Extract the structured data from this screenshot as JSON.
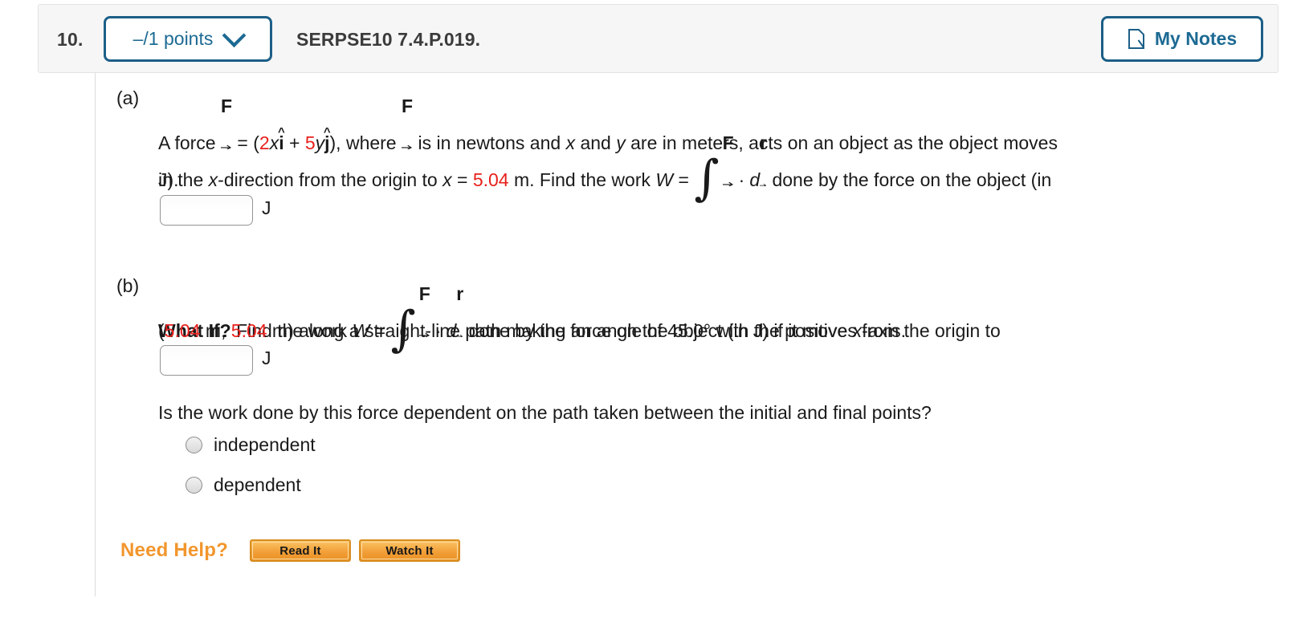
{
  "header": {
    "question_number": "10.",
    "points_label": "–/1 points",
    "points_chevron_icon": "chevron-down-icon",
    "question_code": "SERPSE10 7.4.P.019.",
    "notes_label": "My Notes",
    "notes_icon": "note-page-icon",
    "accent_color": "#1c6a93",
    "background": "#f6f6f6"
  },
  "parts": {
    "a": {
      "label": "(a)",
      "t1": "A force ",
      "force_sym": "F",
      "t2": " = (",
      "coef_x": "2",
      "var_x": "x",
      "ihat": "i",
      "t3": " + ",
      "coef_y": "5",
      "var_y": "y",
      "jhat": "j",
      "t4": "), where ",
      "t5": " is in newtons and ",
      "t6": " and ",
      "t7": " are in meters, acts on an object as the object moves",
      "l2_a": "in the ",
      "l2_x": "x",
      "l2_b": "-direction from the origin to ",
      "l2_xeq": "x",
      "l2_c": " = ",
      "l2_val": "5.04",
      "l2_d": " m. Find the work ",
      "l2_W": "W",
      "l2_e": " = ",
      "integral": "∫",
      "dot": "·",
      "d_sym": "d",
      "r_sym": "r",
      "l2_f": " done by the force on the object (in",
      "l3": "J).",
      "answer_value": "",
      "answer_unit": "J"
    },
    "b": {
      "label": "(b)",
      "whatif": "What If?",
      "t1": " Find the work ",
      "W": "W",
      "t2": " = ",
      "integral": "∫",
      "force_sym": "F",
      "dot": "·",
      "d_sym": "d",
      "r_sym": "r",
      "t3": " done by the force on the object (in J) if it moves from the origin to",
      "l2_open": "(",
      "l2_v1": "5.04",
      "l2_m1": " m, ",
      "l2_v2": "5.04",
      "l2_m2": " m) along a straight-line path making an angle of 45.0° with the positive ",
      "l2_x": "x",
      "l2_end": "-axis.",
      "answer_value": "",
      "answer_unit": "J",
      "sub_question": "Is the work done by this force dependent on the path taken between the initial and final points?",
      "options": [
        {
          "label": "independent",
          "selected": false
        },
        {
          "label": "dependent",
          "selected": false
        }
      ]
    }
  },
  "need_help": {
    "label": "Need Help?",
    "color": "#f2962d",
    "buttons": [
      {
        "label": "Read It"
      },
      {
        "label": "Watch It"
      }
    ]
  }
}
